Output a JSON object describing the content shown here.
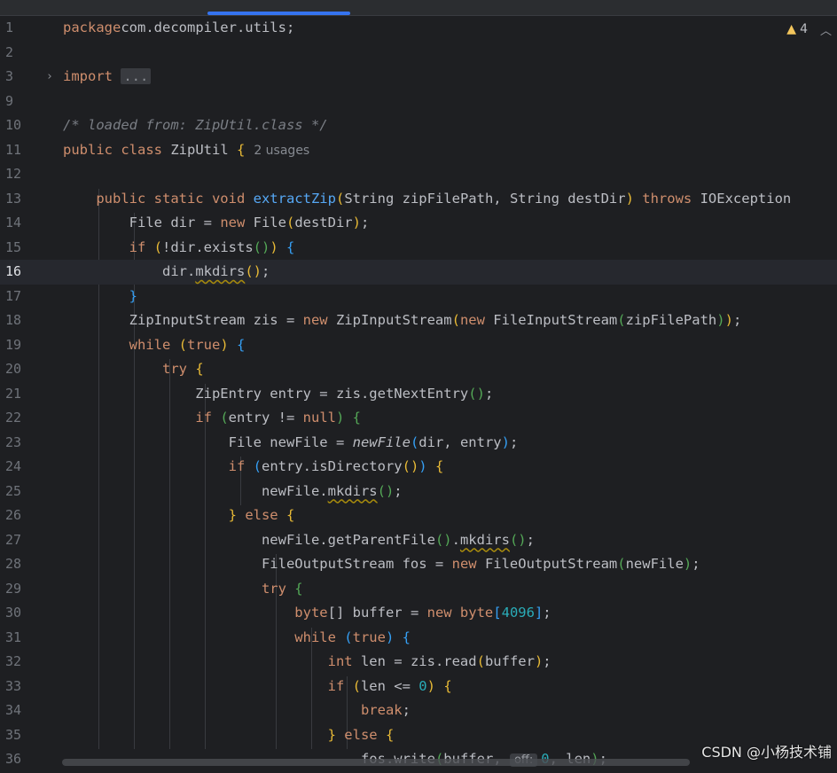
{
  "editor": {
    "warnings": {
      "icon": "warning-triangle-icon",
      "count": "4",
      "collapse_icon": "chevron-up-icon"
    },
    "lines": [
      {
        "n": "1",
        "parts": [
          [
            "kw",
            "package"
          ],
          [
            "",
            "com.decompiler.utils;"
          ]
        ]
      },
      {
        "n": "2",
        "parts": []
      },
      {
        "n": "3",
        "fold": "›",
        "parts": [
          [
            "kw",
            "import "
          ],
          [
            "foldbox",
            "..."
          ]
        ]
      },
      {
        "n": "9",
        "parts": []
      },
      {
        "n": "10",
        "parts": [
          [
            "cm",
            "/* loaded from: ZipUtil.class */"
          ]
        ]
      },
      {
        "n": "11",
        "parts": [
          [
            "kw",
            "public class "
          ],
          [
            "",
            "ZipUtil "
          ],
          [
            "p1",
            "{"
          ],
          [
            "hint",
            "2 usages"
          ]
        ]
      },
      {
        "n": "12",
        "parts": []
      },
      {
        "n": "13",
        "parts": [
          [
            "",
            "    "
          ],
          [
            "kw",
            "public static void "
          ],
          [
            "fn",
            "extractZip"
          ],
          [
            "p1",
            "("
          ],
          [
            "",
            "String zipFilePath, String destDir"
          ],
          [
            "p1",
            ")"
          ],
          [
            "kw",
            " throws "
          ],
          [
            "",
            "IOException"
          ]
        ]
      },
      {
        "n": "14",
        "parts": [
          [
            "",
            "        File dir = "
          ],
          [
            "kw",
            "new "
          ],
          [
            "",
            "File"
          ],
          [
            "p1",
            "("
          ],
          [
            "",
            "destDir"
          ],
          [
            "p1",
            ")"
          ],
          [
            "",
            ";"
          ]
        ]
      },
      {
        "n": "15",
        "parts": [
          [
            "",
            "        "
          ],
          [
            "kw",
            "if "
          ],
          [
            "p1",
            "("
          ],
          [
            "",
            "!dir.exists"
          ],
          [
            "p2",
            "()"
          ],
          [
            "p1",
            ")"
          ],
          [
            "",
            ""
          ],
          [
            "p3",
            " {"
          ]
        ]
      },
      {
        "n": "16",
        "current": true,
        "parts": [
          [
            "",
            "            dir."
          ],
          [
            "warn",
            "mkdirs"
          ],
          [
            "p1",
            "()"
          ],
          [
            "",
            ";"
          ]
        ]
      },
      {
        "n": "17",
        "parts": [
          [
            "",
            "        "
          ],
          [
            "p3",
            "}"
          ]
        ]
      },
      {
        "n": "18",
        "parts": [
          [
            "",
            "        ZipInputStream zis = "
          ],
          [
            "kw",
            "new "
          ],
          [
            "",
            "ZipInputStream"
          ],
          [
            "p1",
            "("
          ],
          [
            "kw",
            "new "
          ],
          [
            "",
            "FileInputStream"
          ],
          [
            "p2",
            "("
          ],
          [
            "",
            "zipFilePath"
          ],
          [
            "p2",
            ")"
          ],
          [
            "p1",
            ")"
          ],
          [
            "",
            ";"
          ]
        ]
      },
      {
        "n": "19",
        "parts": [
          [
            "",
            "        "
          ],
          [
            "kw",
            "while "
          ],
          [
            "p1",
            "("
          ],
          [
            "kw",
            "true"
          ],
          [
            "p1",
            ")"
          ],
          [
            "p3",
            " {"
          ]
        ]
      },
      {
        "n": "20",
        "parts": [
          [
            "",
            "            "
          ],
          [
            "kw",
            "try "
          ],
          [
            "p1",
            "{"
          ]
        ]
      },
      {
        "n": "21",
        "parts": [
          [
            "",
            "                ZipEntry entry = zis.getNextEntry"
          ],
          [
            "p2",
            "()"
          ],
          [
            "",
            ";"
          ]
        ]
      },
      {
        "n": "22",
        "parts": [
          [
            "",
            "                "
          ],
          [
            "kw",
            "if "
          ],
          [
            "p2",
            "("
          ],
          [
            "",
            "entry != "
          ],
          [
            "kw",
            "null"
          ],
          [
            "p2",
            ")"
          ],
          [
            "p2",
            " {"
          ]
        ]
      },
      {
        "n": "23",
        "parts": [
          [
            "",
            "                    File newFile = "
          ],
          [
            "it",
            "newFile"
          ],
          [
            "p3",
            "("
          ],
          [
            "",
            "dir, entry"
          ],
          [
            "p3",
            ")"
          ],
          [
            "",
            ";"
          ]
        ]
      },
      {
        "n": "24",
        "parts": [
          [
            "",
            "                    "
          ],
          [
            "kw",
            "if "
          ],
          [
            "p3",
            "("
          ],
          [
            "",
            "entry.isDirectory"
          ],
          [
            "p1",
            "()"
          ],
          [
            "p3",
            ")"
          ],
          [
            "p1",
            " {"
          ]
        ]
      },
      {
        "n": "25",
        "parts": [
          [
            "",
            "                        newFile."
          ],
          [
            "warn",
            "mkdirs"
          ],
          [
            "p2",
            "()"
          ],
          [
            "",
            ";"
          ]
        ]
      },
      {
        "n": "26",
        "parts": [
          [
            "",
            "                    "
          ],
          [
            "p1",
            "}"
          ],
          [
            "kw",
            " else "
          ],
          [
            "p1",
            "{"
          ]
        ]
      },
      {
        "n": "27",
        "parts": [
          [
            "",
            "                        newFile.getParentFile"
          ],
          [
            "p2",
            "()"
          ],
          [
            "",
            "."
          ],
          [
            "warn",
            "mkdirs"
          ],
          [
            "p2",
            "()"
          ],
          [
            "",
            ";"
          ]
        ]
      },
      {
        "n": "28",
        "parts": [
          [
            "",
            "                        FileOutputStream fos = "
          ],
          [
            "kw",
            "new "
          ],
          [
            "",
            "FileOutputStream"
          ],
          [
            "p2",
            "("
          ],
          [
            "",
            "newFile"
          ],
          [
            "p2",
            ")"
          ],
          [
            "",
            ";"
          ]
        ]
      },
      {
        "n": "29",
        "parts": [
          [
            "",
            "                        "
          ],
          [
            "kw",
            "try "
          ],
          [
            "p2",
            "{"
          ]
        ]
      },
      {
        "n": "30",
        "parts": [
          [
            "",
            "                            "
          ],
          [
            "kw",
            "byte"
          ],
          [
            "",
            "[] buffer = "
          ],
          [
            "kw",
            "new byte"
          ],
          [
            "p3",
            "["
          ],
          [
            "num",
            "4096"
          ],
          [
            "p3",
            "]"
          ],
          [
            "",
            ";"
          ]
        ]
      },
      {
        "n": "31",
        "parts": [
          [
            "",
            "                            "
          ],
          [
            "kw",
            "while "
          ],
          [
            "p3",
            "("
          ],
          [
            "kw",
            "true"
          ],
          [
            "p3",
            ")"
          ],
          [
            "p3",
            " {"
          ]
        ]
      },
      {
        "n": "32",
        "parts": [
          [
            "",
            "                                "
          ],
          [
            "kw",
            "int "
          ],
          [
            "",
            "len = zis.read"
          ],
          [
            "p1",
            "("
          ],
          [
            "",
            "buffer"
          ],
          [
            "p1",
            ")"
          ],
          [
            "",
            ";"
          ]
        ]
      },
      {
        "n": "33",
        "parts": [
          [
            "",
            "                                "
          ],
          [
            "kw",
            "if "
          ],
          [
            "p1",
            "("
          ],
          [
            "",
            "len <= "
          ],
          [
            "num",
            "0"
          ],
          [
            "p1",
            ")"
          ],
          [
            "p1",
            " {"
          ]
        ]
      },
      {
        "n": "34",
        "parts": [
          [
            "",
            "                                    "
          ],
          [
            "kw",
            "break"
          ],
          [
            "",
            ";"
          ]
        ]
      },
      {
        "n": "35",
        "parts": [
          [
            "",
            "                                "
          ],
          [
            "p1",
            "}"
          ],
          [
            "kw",
            " else "
          ],
          [
            "p1",
            "{"
          ]
        ]
      },
      {
        "n": "36",
        "parts": [
          [
            "",
            "                                    fos.write"
          ],
          [
            "p2",
            "("
          ],
          [
            "",
            "buffer, "
          ],
          [
            "param",
            "off:"
          ],
          [
            "num",
            "0"
          ],
          [
            "",
            ", len"
          ],
          [
            "p2",
            ")"
          ],
          [
            "",
            ";"
          ]
        ]
      }
    ]
  },
  "watermark": "CSDN @小杨技术铺"
}
